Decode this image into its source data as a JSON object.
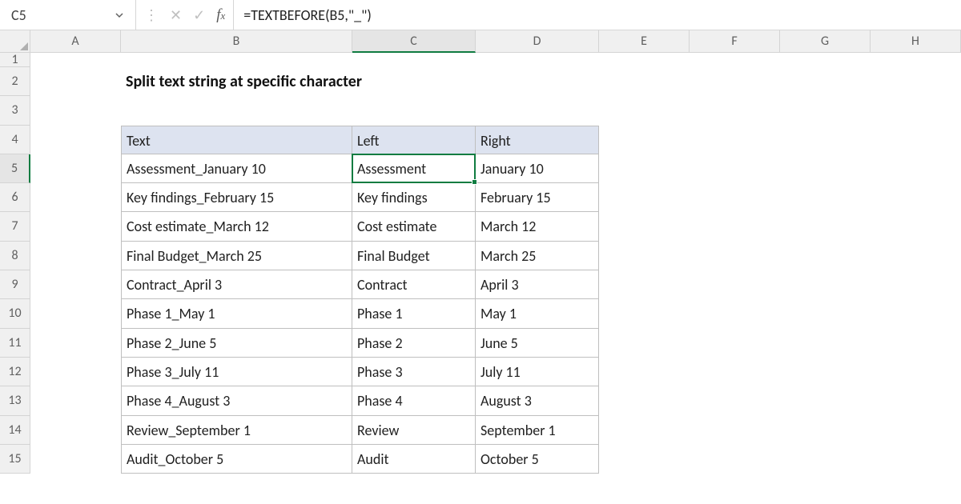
{
  "namebox": {
    "value": "C5"
  },
  "formula": {
    "value": "=TEXTBEFORE(B5,\"_\")"
  },
  "colHeaders": [
    "A",
    "B",
    "C",
    "D",
    "E",
    "F",
    "G",
    "H"
  ],
  "rowHeaders": [
    "1",
    "2",
    "3",
    "4",
    "5",
    "6",
    "7",
    "8",
    "9",
    "10",
    "11",
    "12",
    "13",
    "14",
    "15"
  ],
  "title": "Split text string at specific character",
  "table": {
    "headers": {
      "text": "Text",
      "left": "Left",
      "right": "Right"
    },
    "rows": [
      {
        "text": "Assessment_January 10",
        "left": "Assessment",
        "right": "January 10"
      },
      {
        "text": "Key findings_February 15",
        "left": "Key findings",
        "right": "February 15"
      },
      {
        "text": "Cost estimate_March 12",
        "left": "Cost estimate",
        "right": "March 12"
      },
      {
        "text": "Final Budget_March 25",
        "left": "Final Budget",
        "right": "March 25"
      },
      {
        "text": "Contract_April 3",
        "left": "Contract",
        "right": "April 3"
      },
      {
        "text": "Phase 1_May 1",
        "left": "Phase 1",
        "right": "May 1"
      },
      {
        "text": "Phase 2_June 5",
        "left": "Phase 2",
        "right": "June 5"
      },
      {
        "text": "Phase 3_July 11",
        "left": "Phase 3",
        "right": "July 11"
      },
      {
        "text": "Phase 4_August 3",
        "left": "Phase 4",
        "right": "August 3"
      },
      {
        "text": "Review_September 1",
        "left": "Review",
        "right": "September 1"
      },
      {
        "text": "Audit_October 5",
        "left": "Audit",
        "right": "October 5"
      }
    ]
  },
  "activeCell": {
    "row": 5,
    "col": "C"
  }
}
